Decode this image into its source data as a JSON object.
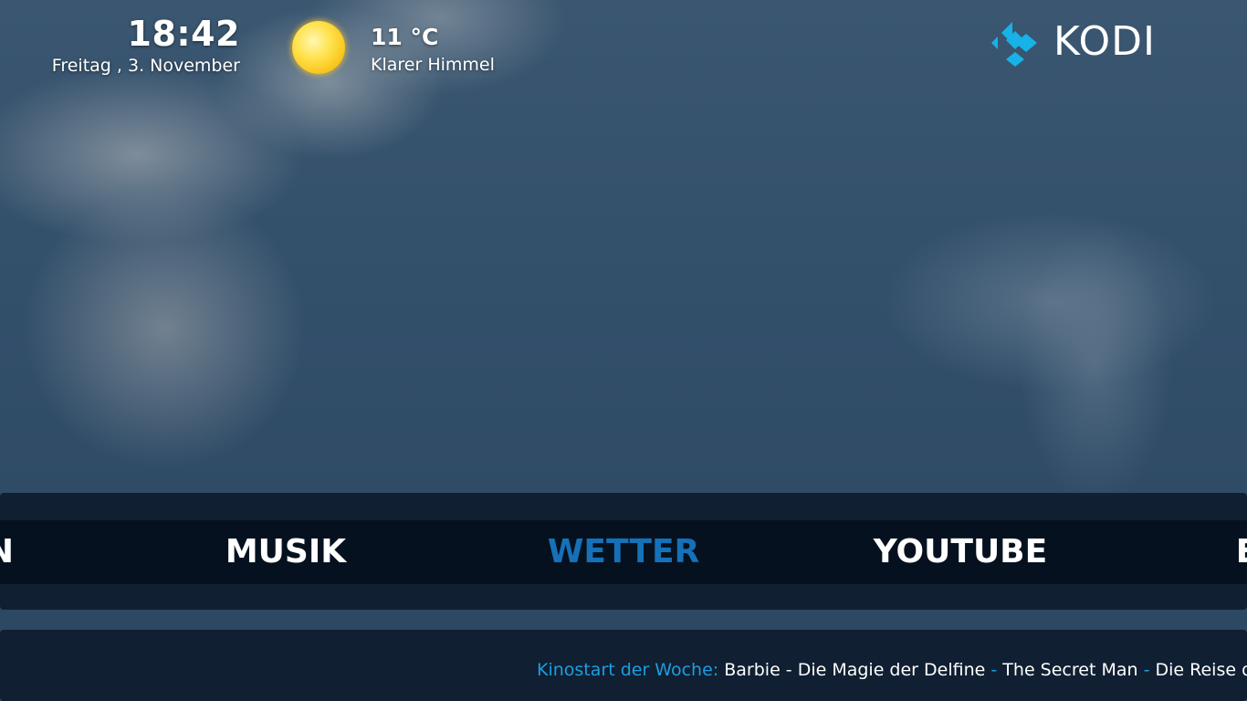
{
  "colors": {
    "accent": "#1c9ee0",
    "active_menu": "#1571b8",
    "band_background": "#0e1c2e"
  },
  "header": {
    "time": "18:42",
    "date": "Freitag , 3. November",
    "weather": {
      "icon": "sun-icon",
      "temperature": "11 °C",
      "condition": "Klarer Himmel"
    },
    "logo_text": "KODI"
  },
  "menu": {
    "items": [
      {
        "label": "N",
        "active": false
      },
      {
        "label": "MUSIK",
        "active": false
      },
      {
        "label": "WETTER",
        "active": true
      },
      {
        "label": "YOUTUBE",
        "active": false
      },
      {
        "label": "E",
        "active": false
      }
    ]
  },
  "ticker": {
    "label": "Kinostart der Woche:",
    "items": [
      "Barbie - Die Magie der Delfine",
      "The Secret Man",
      "Die Reise der Pin"
    ],
    "separator": "-"
  }
}
